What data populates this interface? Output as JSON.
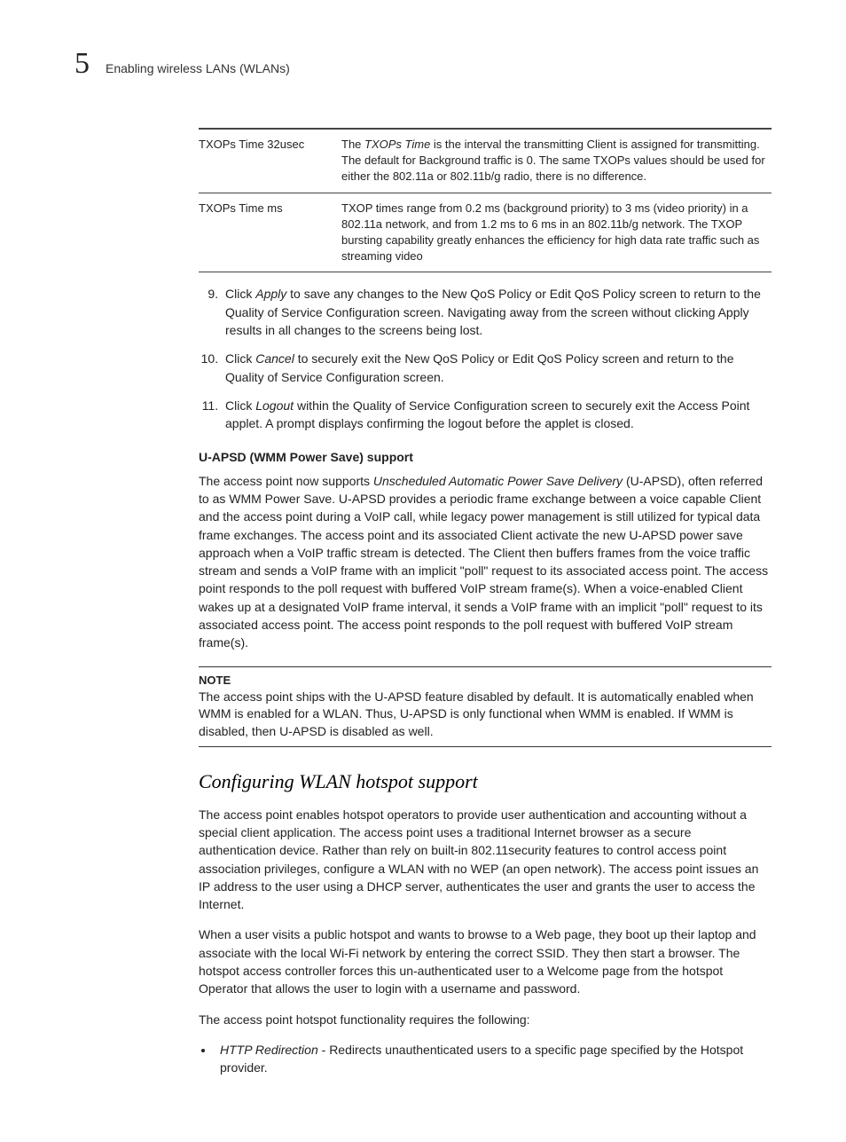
{
  "header": {
    "chapter_number": "5",
    "chapter_title": "Enabling wireless LANs (WLANs)"
  },
  "table": {
    "rows": [
      {
        "term": "TXOPs Time 32usec",
        "def_pre": "The ",
        "def_ital": "TXOPs Time",
        "def_post": " is the interval the transmitting Client is assigned for transmitting. The default for Background traffic is 0. The same TXOPs values should be used for either the 802.11a or 802.11b/g radio, there is no difference."
      },
      {
        "term": "TXOPs Time ms",
        "def_pre": "",
        "def_ital": "",
        "def_post": "TXOP times range from 0.2 ms (background priority) to 3 ms (video priority) in a 802.11a network, and from 1.2 ms to 6 ms in an 802.11b/g network. The TXOP bursting capability greatly enhances the efficiency for high data rate traffic such as streaming video"
      }
    ]
  },
  "steps": [
    {
      "pre": "Click ",
      "cmd": "Apply",
      "post": " to save any changes to the New QoS Policy or Edit QoS Policy screen to return to the Quality of Service Configuration screen. Navigating away from the screen without clicking Apply results in all changes to the screens being lost."
    },
    {
      "pre": "Click ",
      "cmd": "Cancel",
      "post": " to securely exit the New QoS Policy or Edit QoS Policy screen and return to the Quality of Service Configuration screen."
    },
    {
      "pre": "Click ",
      "cmd": "Logout",
      "post": " within the Quality of Service Configuration screen to securely exit the Access Point applet. A prompt displays confirming the logout before the applet is closed."
    }
  ],
  "uapsd": {
    "heading": "U-APSD (WMM Power Save) support",
    "body_pre": "The access point now supports ",
    "body_ital": "Unscheduled Automatic Power Save Delivery",
    "body_post": " (U-APSD), often referred to as WMM Power Save. U-APSD provides a periodic frame exchange between a voice capable Client and the access point during a VoIP call, while legacy power management is still utilized for typical data frame exchanges. The access point and its associated Client activate the new U-APSD power save approach when a VoIP traffic stream is detected. The Client then buffers frames from the voice traffic stream and sends a VoIP frame with an implicit \"poll\" request to its associated access point. The access point responds to the poll request with buffered VoIP stream frame(s). When a voice-enabled Client wakes up at a designated VoIP frame interval, it sends a VoIP frame with an implicit \"poll\" request to its associated access point. The access point responds to the poll request with buffered VoIP stream frame(s)."
  },
  "note": {
    "label": "NOTE",
    "body": "The access point ships with the U-APSD feature disabled by default. It is automatically enabled when WMM is enabled for a WLAN. Thus, U-APSD is only functional when WMM is enabled. If WMM is disabled, then U-APSD is disabled as well."
  },
  "section_heading": "Configuring WLAN hotspot support",
  "hotspot_paras": [
    "The access point enables hotspot operators to provide user authentication and accounting without a special client application. The access point uses a traditional Internet browser as a secure authentication device. Rather than rely on built-in 802.11security features to control access point association privileges, configure a WLAN with no WEP (an open network). The access point issues an IP address to the user using a DHCP server, authenticates the user and grants the user to access the Internet.",
    "When a user visits a public hotspot and wants to browse to a Web page, they boot up their laptop and associate with the local Wi-Fi network by entering the correct SSID. They then start a browser. The hotspot access controller forces this un-authenticated user to a Welcome page from the hotspot Operator that allows the user to login with a username and password.",
    "The access point hotspot functionality requires the following:"
  ],
  "bullet": {
    "ital": "HTTP Redirection",
    "rest": " - Redirects unauthenticated users to a specific page specified by the Hotspot provider."
  }
}
